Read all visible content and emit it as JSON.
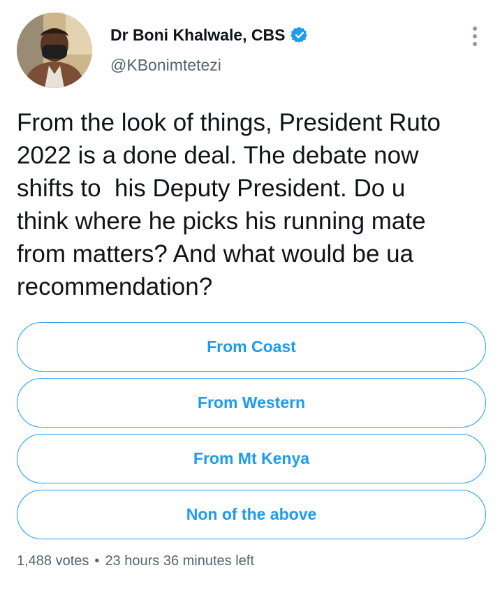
{
  "author": {
    "display_name": "Dr Boni Khalwale, CBS",
    "handle": "@KBonimtetezi",
    "verified": true
  },
  "tweet": {
    "text": "From the look of things, President Ruto\n2022 is a done deal. The debate now\nshifts to  his Deputy President. Do u\nthink where he picks his running mate\nfrom matters? And what would be ua\nrecommendation?"
  },
  "poll": {
    "options": [
      {
        "label": "From Coast"
      },
      {
        "label": "From Western"
      },
      {
        "label": "From Mt Kenya"
      },
      {
        "label": "Non of the above"
      }
    ],
    "votes": "1,488 votes",
    "separator": "•",
    "time_left": "23 hours 36 minutes left"
  },
  "colors": {
    "accent": "#1d9bf0",
    "secondary_text": "#536471",
    "primary_text": "#0f1419"
  },
  "icons": {
    "verified": "verified-badge-icon",
    "more": "more-options-icon"
  }
}
